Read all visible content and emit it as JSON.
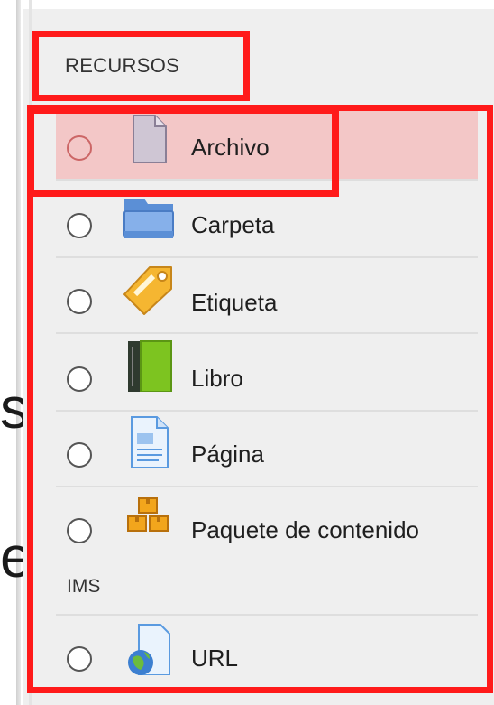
{
  "background_text": [
    "s",
    "e"
  ],
  "section": {
    "title": "RECURSOS"
  },
  "resources": [
    {
      "label": "Archivo",
      "icon": "file-icon",
      "selected": false,
      "highlighted": true
    },
    {
      "label": "Carpeta",
      "icon": "folder-icon",
      "selected": false,
      "highlighted": false
    },
    {
      "label": "Etiqueta",
      "icon": "tag-icon",
      "selected": false,
      "highlighted": false
    },
    {
      "label": "Libro",
      "icon": "book-icon",
      "selected": false,
      "highlighted": false
    },
    {
      "label": "Página",
      "icon": "page-icon",
      "selected": false,
      "highlighted": false
    },
    {
      "label": "Paquete de contenido",
      "label_continued": "IMS",
      "icon": "ims-package-icon",
      "selected": false,
      "highlighted": false
    },
    {
      "label": "URL",
      "icon": "url-icon",
      "selected": false,
      "highlighted": false
    }
  ],
  "colors": {
    "annotation": "#ff1a1a",
    "highlight": "#f3c7c7",
    "panel": "#efefef"
  }
}
